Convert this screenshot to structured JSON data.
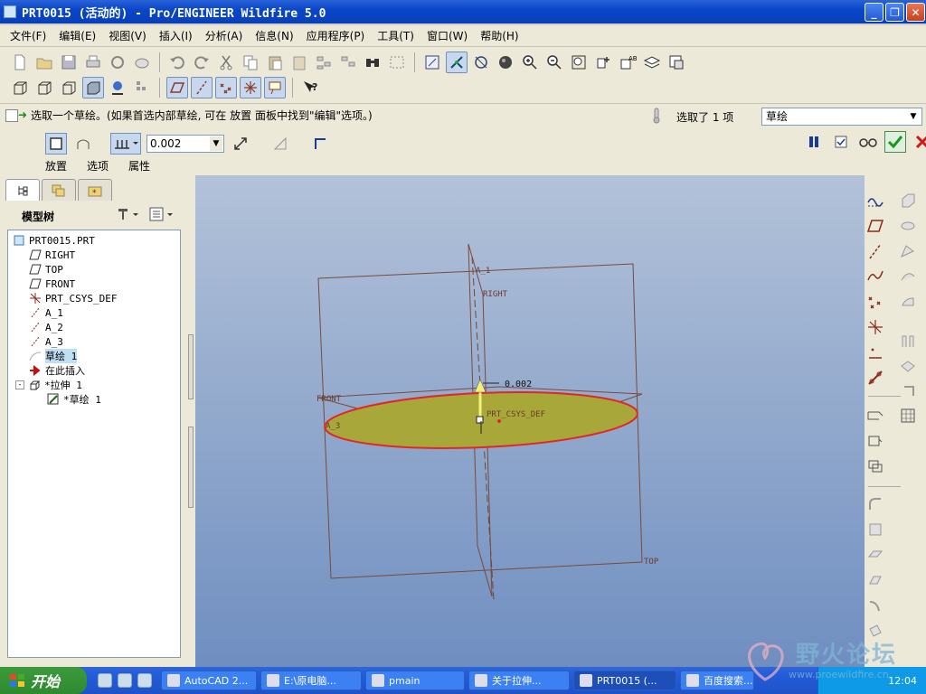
{
  "window": {
    "title": "PRT0015 (活动的) - Pro/ENGINEER Wildfire 5.0",
    "controls": [
      "_",
      "❐",
      "✕"
    ]
  },
  "menubar": {
    "items": [
      "文件(F)",
      "编辑(E)",
      "视图(V)",
      "插入(I)",
      "分析(A)",
      "信息(N)",
      "应用程序(P)",
      "工具(T)",
      "窗口(W)",
      "帮助(H)"
    ]
  },
  "toolbar": {
    "row1_icons": [
      "new-icon",
      "open-icon",
      "save-icon",
      "print-icon",
      "send-icon",
      "save-copy-icon",
      "undo-icon",
      "redo-icon",
      "cut-icon",
      "copy-icon",
      "paste-icon",
      "paste-special-icon",
      "regenerate-icon",
      "regen-manager-icon",
      "find-icon",
      "selection-box-icon",
      "repaint-icon",
      "spin-center-icon",
      "orientation-icon",
      "shading-icon",
      "zoom-in-icon",
      "zoom-out-icon",
      "refit-icon",
      "reorient-icon",
      "saved-views-icon",
      "layers-icon",
      "view-manager-icon"
    ],
    "row2_icons": [
      "wireframe-icon",
      "hidden-line-icon",
      "no-hidden-icon",
      "shading-mode-icon",
      "enhanced-realism-icon",
      "display-style-icon",
      "datum-plane-display-icon",
      "datum-axis-display-icon",
      "datum-point-display-icon",
      "csys-display-icon",
      "annotation-display-icon",
      "whats-this-icon"
    ]
  },
  "dashboard": {
    "prompt": "选取一个草绘。(如果首选内部草绘, 可在 放置 面板中找到\"编辑\"选项。)",
    "selected_count": "选取了 1 项",
    "filter": "草绘",
    "depth_value": "0.002",
    "tabs": [
      "放置",
      "选项",
      "属性"
    ]
  },
  "model_tree": {
    "title": "模型树",
    "items": [
      {
        "label": "PRT0015.PRT",
        "icon": "part-icon",
        "level": 0
      },
      {
        "label": "RIGHT",
        "icon": "datum-plane-icon",
        "level": 1
      },
      {
        "label": "TOP",
        "icon": "datum-plane-icon",
        "level": 1
      },
      {
        "label": "FRONT",
        "icon": "datum-plane-icon",
        "level": 1
      },
      {
        "label": "PRT_CSYS_DEF",
        "icon": "csys-icon",
        "level": 1
      },
      {
        "label": "A_1",
        "icon": "datum-axis-icon",
        "level": 1
      },
      {
        "label": "A_2",
        "icon": "datum-axis-icon",
        "level": 1
      },
      {
        "label": "A_3",
        "icon": "datum-axis-icon",
        "level": 1
      },
      {
        "label": "草绘 1",
        "icon": "sketch-icon",
        "level": 1,
        "selected": true
      },
      {
        "label": "在此插入",
        "icon": "insert-here-icon",
        "level": 1
      },
      {
        "label": "*拉伸 1",
        "icon": "extrude-icon",
        "level": 1
      },
      {
        "label": "*草绘 1",
        "icon": "sketch-edit-icon",
        "level": 2
      }
    ]
  },
  "graphics": {
    "plane_labels": [
      "RIGHT",
      "FRONT",
      "TOP"
    ],
    "axis_labels": [
      "A_1",
      "A_3"
    ],
    "csys_label": "PRT_CSYS_DEF",
    "depth_label": "0.002",
    "colors": {
      "sketch_fill": "#a8a83a",
      "sketch_edge": "#e02828",
      "datum_plane": "#8b5a4a",
      "handle": "#f6f07a"
    }
  },
  "taskbar": {
    "start": "开始",
    "tasks": [
      "AutoCAD 2...",
      "E:\\原电脑...",
      "pmain",
      "关于拉伸...",
      "PRT0015 (...",
      "百度搜索..."
    ],
    "clock": "12:04"
  },
  "watermark": {
    "text": "野火论坛",
    "url": "www.proewildfire.cn"
  }
}
